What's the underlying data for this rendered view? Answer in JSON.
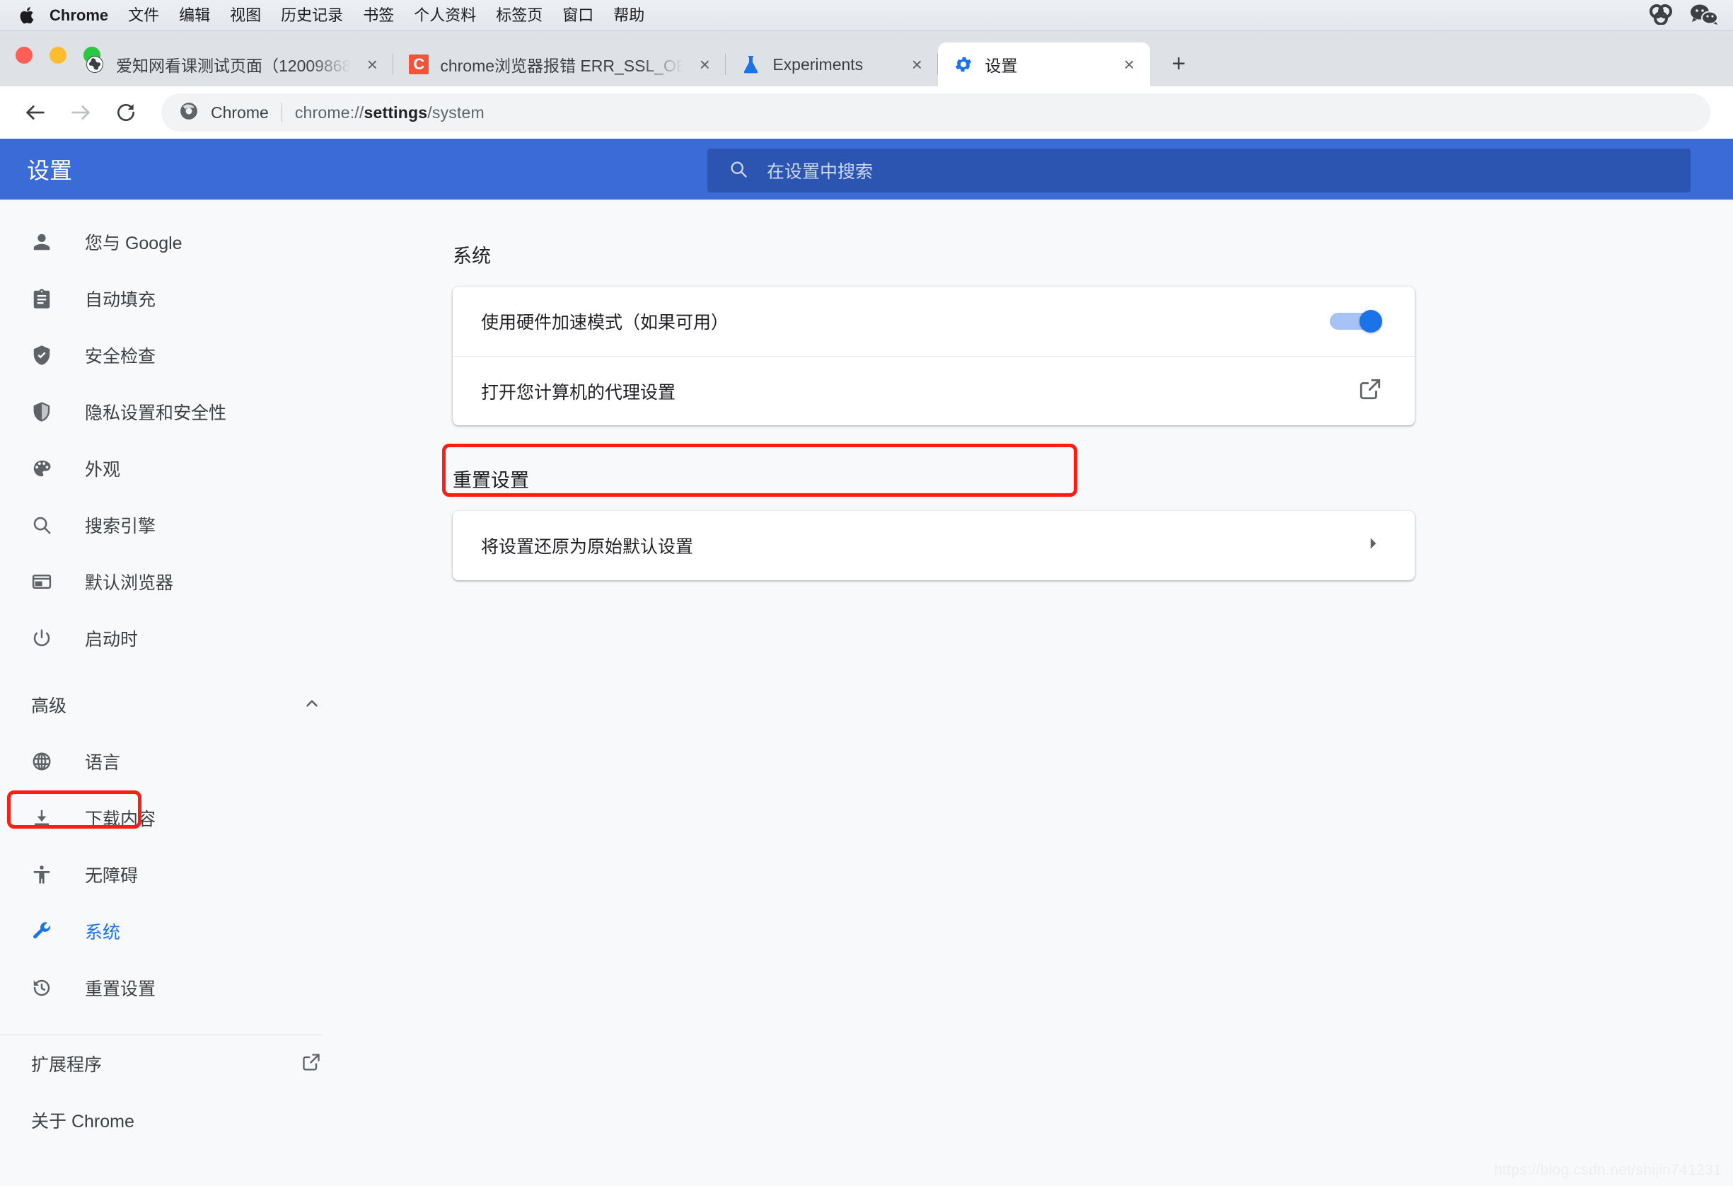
{
  "macmenu": {
    "apple_icon": "apple-logo-icon",
    "items": [
      {
        "label": "Chrome",
        "bold": true
      },
      {
        "label": "文件",
        "bold": false
      },
      {
        "label": "编辑",
        "bold": false
      },
      {
        "label": "视图",
        "bold": false
      },
      {
        "label": "历史记录",
        "bold": false
      },
      {
        "label": "书签",
        "bold": false
      },
      {
        "label": "个人资料",
        "bold": false
      },
      {
        "label": "标签页",
        "bold": false
      },
      {
        "label": "窗口",
        "bold": false
      },
      {
        "label": "帮助",
        "bold": false
      }
    ],
    "status_icons": [
      "baidu-netdisk-icon",
      "wechat-icon"
    ]
  },
  "window_controls": {
    "close": "close-window-button",
    "minimize": "minimize-window-button",
    "maximize": "maximize-window-button"
  },
  "tabs": [
    {
      "title": "爱知网看课测试页面（12009868",
      "favicon": "globe-icon",
      "active": false,
      "close": "×"
    },
    {
      "title": "chrome浏览器报错 ERR_SSL_OB",
      "favicon": "csdn-c-icon",
      "active": false,
      "close": "×"
    },
    {
      "title": "Experiments",
      "favicon": "flask-icon",
      "active": false,
      "close": "×"
    },
    {
      "title": "设置",
      "favicon": "gear-icon",
      "active": true,
      "close": "×"
    }
  ],
  "newtab_label": "+",
  "toolbar": {
    "back": "←",
    "forward": "→",
    "reload": "⟳",
    "omnibox": {
      "chip": "Chrome",
      "url_prefix": "chrome://",
      "url_bold": "settings",
      "url_suffix": "/system"
    }
  },
  "settings": {
    "title": "设置",
    "search_placeholder": "在设置中搜索"
  },
  "sidebar": {
    "items": [
      {
        "label": "您与 Google",
        "icon": "person-icon",
        "selected": false
      },
      {
        "label": "自动填充",
        "icon": "clipboard-icon",
        "selected": false
      },
      {
        "label": "安全检查",
        "icon": "shield-check-icon",
        "selected": false
      },
      {
        "label": "隐私设置和安全性",
        "icon": "shield-icon",
        "selected": false
      },
      {
        "label": "外观",
        "icon": "palette-icon",
        "selected": false
      },
      {
        "label": "搜索引擎",
        "icon": "search-icon",
        "selected": false
      },
      {
        "label": "默认浏览器",
        "icon": "browser-window-icon",
        "selected": false
      },
      {
        "label": "启动时",
        "icon": "power-icon",
        "selected": false
      }
    ],
    "advanced": {
      "label": "高级",
      "chevron": "chevron-up-icon"
    },
    "advanced_items": [
      {
        "label": "语言",
        "icon": "globe-icon",
        "selected": false
      },
      {
        "label": "下载内容",
        "icon": "download-icon",
        "selected": false
      },
      {
        "label": "无障碍",
        "icon": "accessibility-icon",
        "selected": false
      },
      {
        "label": "系统",
        "icon": "wrench-icon",
        "selected": true
      },
      {
        "label": "重置设置",
        "icon": "history-restore-icon",
        "selected": false
      }
    ],
    "bottom_items": [
      {
        "label": "扩展程序",
        "icon": "external-link-icon"
      },
      {
        "label": "关于 Chrome",
        "icon": ""
      }
    ]
  },
  "main": {
    "system_section": {
      "title": "系统",
      "rows": [
        {
          "label": "使用硬件加速模式（如果可用）",
          "control": "toggle",
          "toggle_on": true
        },
        {
          "label": "打开您计算机的代理设置",
          "control": "external-link-icon"
        }
      ]
    },
    "reset_section": {
      "title": "重置设置",
      "rows": [
        {
          "label": "将设置还原为原始默认设置",
          "control": "chevron-right-icon"
        }
      ]
    }
  },
  "annotations": [
    {
      "name": "annot-sidebar-system",
      "color": "#fc1d14"
    },
    {
      "name": "annot-proxy-row",
      "color": "#fc1d14"
    }
  ],
  "watermark": "https://blog.csdn.net/shijin741231"
}
